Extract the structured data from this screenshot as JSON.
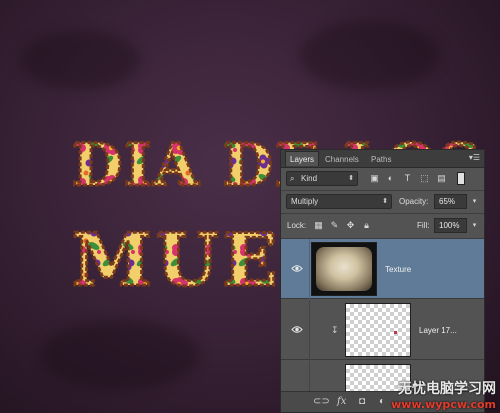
{
  "canvas": {
    "headline_line1": "DIA DE LOS",
    "headline_line2": "MUER",
    "colors": {
      "background": "#3a2338",
      "letter_fill": "#f2cf6a",
      "stitch": "#7a3a1a"
    }
  },
  "layers_panel": {
    "tabs": [
      {
        "label": "Layers",
        "active": true
      },
      {
        "label": "Channels",
        "active": false
      },
      {
        "label": "Paths",
        "active": false
      }
    ],
    "filter": {
      "kind_label": "Kind"
    },
    "blend_mode": "Multiply",
    "opacity_label": "Opacity:",
    "opacity_value": "65%",
    "lock_label": "Lock:",
    "fill_label": "Fill:",
    "fill_value": "100%",
    "layers": [
      {
        "name": "Texture",
        "selected": true,
        "visible": true,
        "clipped": false
      },
      {
        "name": "Layer 17...",
        "selected": false,
        "visible": true,
        "clipped": true
      },
      {
        "name": "",
        "selected": false,
        "visible": false,
        "clipped": false
      }
    ],
    "colors": {
      "panel": "#535353",
      "selected_row": "#5f7b98"
    }
  },
  "watermark": {
    "text_cn": "无忧电脑学习网",
    "text_url": "www.wypcw.com"
  }
}
